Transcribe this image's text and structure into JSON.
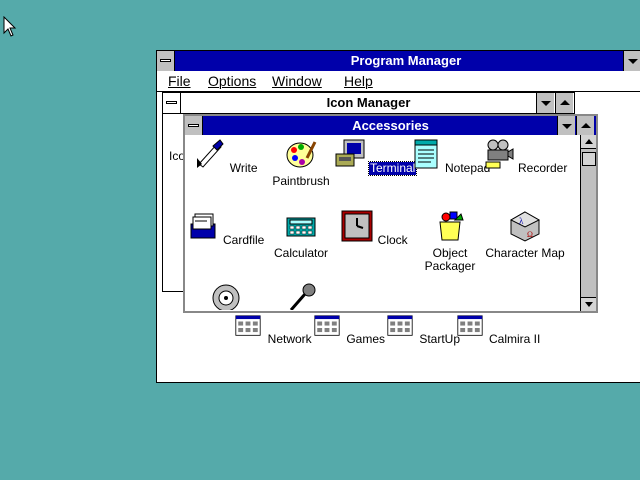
{
  "program_manager": {
    "title": "Program Manager",
    "menu": {
      "file": "File",
      "options": "Options",
      "window": "Window",
      "help": "Help"
    }
  },
  "icon_manager": {
    "title": "Icon Manager",
    "clipped_label": "Ico"
  },
  "accessories": {
    "title": "Accessories",
    "icons": [
      {
        "label": "Write",
        "icon": "write-icon"
      },
      {
        "label": "Paintbrush",
        "icon": "paintbrush-icon"
      },
      {
        "label": "Terminal",
        "icon": "terminal-icon",
        "selected": true
      },
      {
        "label": "Notepad",
        "icon": "notepad-icon"
      },
      {
        "label": "Recorder",
        "icon": "recorder-icon"
      },
      {
        "label": "Cardfile",
        "icon": "cardfile-icon"
      },
      {
        "label": "Calculator",
        "icon": "calculator-icon"
      },
      {
        "label": "Clock",
        "icon": "clock-icon"
      },
      {
        "label": "Object Packager",
        "icon": "object-packager-icon"
      },
      {
        "label": "Character Map",
        "icon": "character-map-icon"
      },
      {
        "label": "",
        "icon": "media-player-icon"
      },
      {
        "label": "",
        "icon": "sound-recorder-icon"
      }
    ]
  },
  "group_icons": [
    {
      "label": "Network",
      "icon": "program-group-icon"
    },
    {
      "label": "Games",
      "icon": "program-group-icon"
    },
    {
      "label": "StartUp",
      "icon": "program-group-icon"
    },
    {
      "label": "Calmira II",
      "icon": "program-group-icon"
    }
  ],
  "colors": {
    "desktop": "#55aaaa",
    "active_title": "#0000aa",
    "selection": "#0000aa"
  }
}
